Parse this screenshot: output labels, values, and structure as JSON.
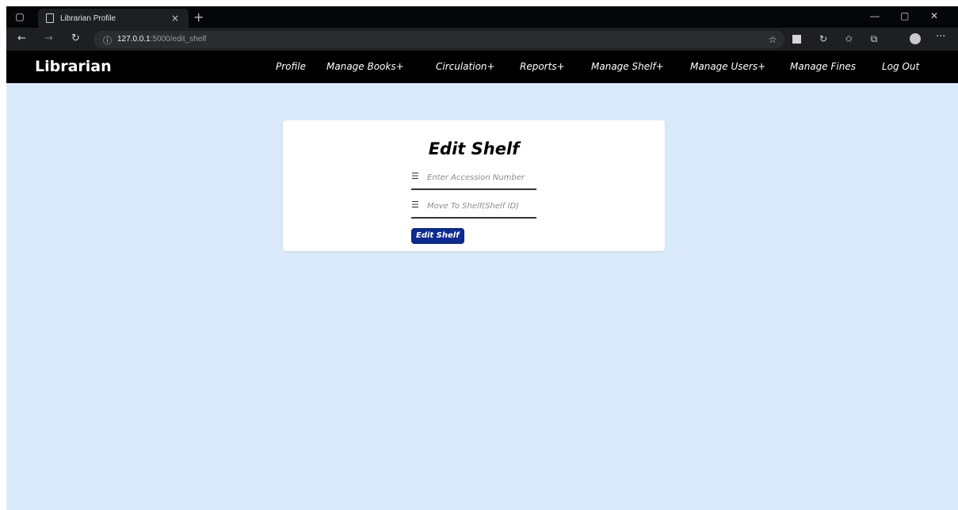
{
  "browser": {
    "tab_title": "Librarian Profile",
    "tab_close": "×",
    "new_tab": "+",
    "url_host": "127.0.0.1",
    "url_path": ":5000/edit_shelf",
    "window_controls": {
      "minimize": "—",
      "maximize": "▢",
      "close": "✕"
    },
    "nav": {
      "back": "←",
      "forward": "→",
      "reload": "↻",
      "info": "ⓘ",
      "more": "···"
    }
  },
  "navbar": {
    "brand": "Librarian",
    "items": [
      {
        "label": "Profile"
      },
      {
        "label": "Manage Books+"
      },
      {
        "label": "Circulation+"
      },
      {
        "label": "Reports+"
      },
      {
        "label": "Manage Shelf+"
      },
      {
        "label": "Manage Users+"
      },
      {
        "label": "Manage Fines"
      },
      {
        "label": "Log Out"
      }
    ]
  },
  "form": {
    "title": "Edit Shelf",
    "accession": {
      "placeholder": "Enter Accession Number",
      "value": "",
      "icon": "list-icon"
    },
    "shelf": {
      "placeholder": "Move To Shelf(Shelf ID)",
      "value": "",
      "icon": "list-icon"
    },
    "submit_label": "Edit Shelf"
  },
  "colors": {
    "page_background": "#dbeafb",
    "navbar": "#000000",
    "button": "#0d2b8c"
  }
}
